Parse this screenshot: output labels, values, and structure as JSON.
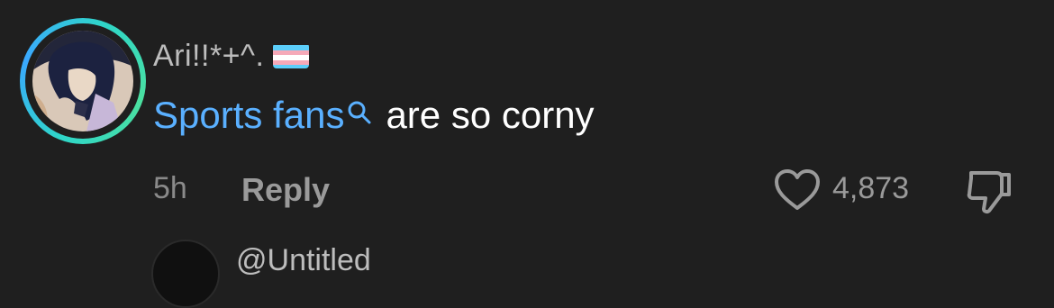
{
  "comment": {
    "username": "Ari!!*+^.",
    "link_text": "Sports fans",
    "text": " are so corny",
    "time": "5h",
    "reply_label": "Reply",
    "likes": "4,873",
    "accent_color": "#5ab0ff"
  },
  "next_comment": {
    "username": "@Untitled"
  },
  "icons": {
    "flag": "transgender-flag-icon",
    "search": "search-icon",
    "like": "heart-icon",
    "dislike": "thumbs-down-icon"
  }
}
